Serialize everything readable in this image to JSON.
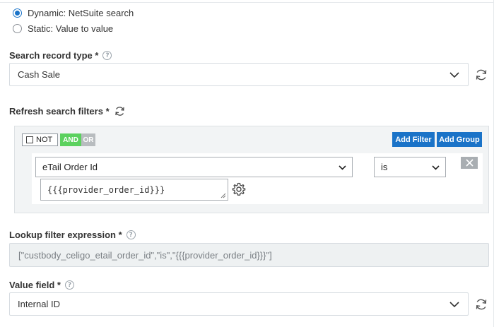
{
  "source_options": [
    {
      "label": "Dynamic: NetSuite search",
      "selected": true
    },
    {
      "label": "Static: Value to value",
      "selected": false
    }
  ],
  "search_record_type": {
    "label": "Search record type *",
    "value": "Cash Sale"
  },
  "refresh_filters": {
    "label": "Refresh search filters *"
  },
  "filter_builder": {
    "not_label": "NOT",
    "and_label": "AND",
    "or_label": "OR",
    "add_filter_label": "Add Filter",
    "add_group_label": "Add Group",
    "rule": {
      "field": "eTail Order Id",
      "operator": "is",
      "value": "{{{provider_order_id}}}"
    }
  },
  "lookup_filter_expression": {
    "label": "Lookup filter expression *",
    "value": "[\"custbody_celigo_etail_order_id\",\"is\",\"{{{provider_order_id}}}\"]"
  },
  "value_field": {
    "label": "Value field *",
    "value": "Internal ID"
  },
  "icons": {
    "help": "question-circle-icon",
    "refresh": "refresh-icon",
    "gear": "gear-icon",
    "close": "close-icon"
  },
  "colors": {
    "accent": "#1a73c8",
    "and_active": "#5bd15e",
    "or_inactive": "#b8bcbf"
  }
}
